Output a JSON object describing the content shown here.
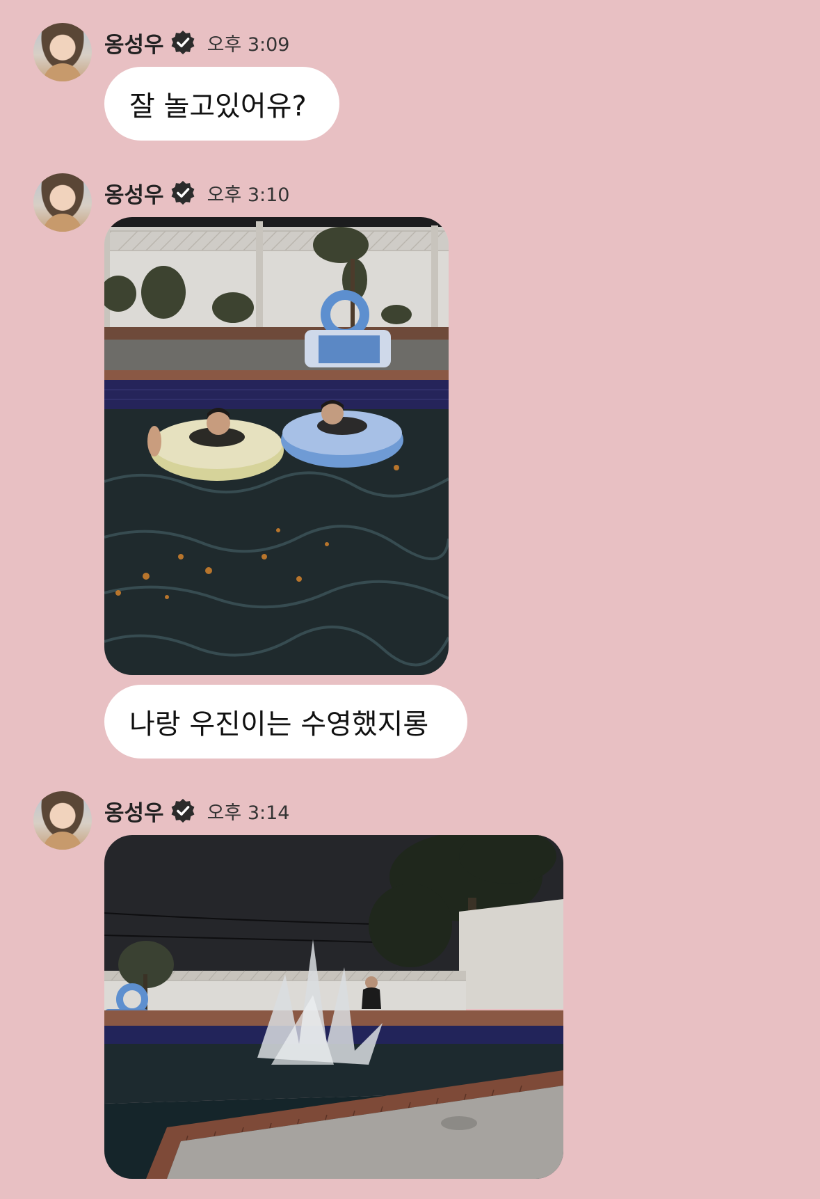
{
  "messages": [
    {
      "sender": "옹성우",
      "time": "오후 3:09",
      "items": [
        {
          "type": "text",
          "text": "잘 놀고있어유?"
        }
      ]
    },
    {
      "sender": "옹성우",
      "time": "오후 3:10",
      "items": [
        {
          "type": "image"
        },
        {
          "type": "text",
          "text": "나랑 우진이는 수영했지롱"
        }
      ]
    },
    {
      "sender": "옹성우",
      "time": "오후 3:14",
      "items": [
        {
          "type": "image"
        }
      ]
    }
  ],
  "colors": {
    "background": "#e8c0c3",
    "bubble": "#ffffff",
    "verified_badge": "#2b2b2b"
  },
  "icons": {
    "verified": "verified-badge-icon",
    "avatar": "profile-avatar"
  }
}
